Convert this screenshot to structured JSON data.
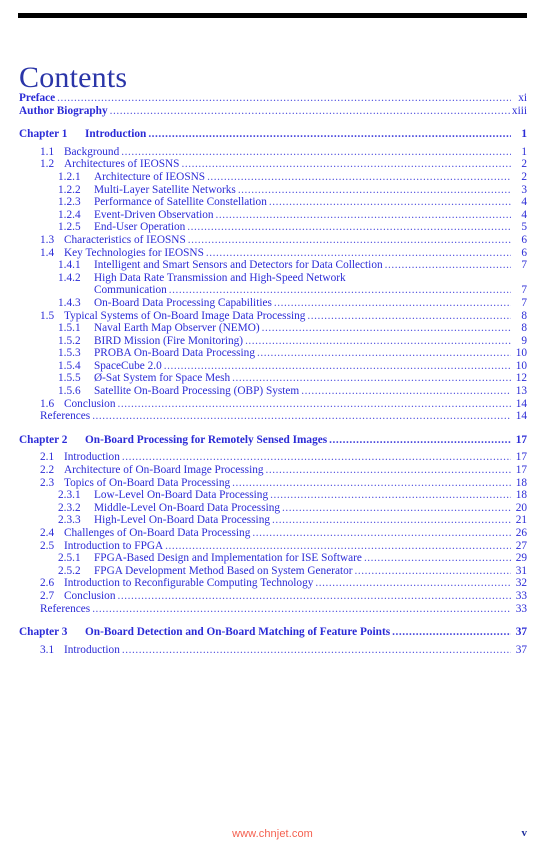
{
  "document": {
    "title": "Contents",
    "title_color": "#2a35a8",
    "text_color": "#2b2bd6",
    "rule_color": "#000000"
  },
  "front_matter": [
    {
      "number": "",
      "label": "Preface",
      "page": "xi"
    },
    {
      "number": "",
      "label": "Author Biography",
      "page": "xiii"
    }
  ],
  "chapters": [
    {
      "number": "Chapter 1",
      "label": "Introduction",
      "page": "1",
      "entries": [
        {
          "level": "sec",
          "number": "1.1",
          "label": "Background",
          "page": "1"
        },
        {
          "level": "sec",
          "number": "1.2",
          "label": "Architectures of IEOSNS",
          "page": "2"
        },
        {
          "level": "sub",
          "number": "1.2.1",
          "label": "Architecture of IEOSNS",
          "page": "2"
        },
        {
          "level": "sub",
          "number": "1.2.2",
          "label": "Multi-Layer Satellite Networks",
          "page": "3"
        },
        {
          "level": "sub",
          "number": "1.2.3",
          "label": "Performance of Satellite Constellation",
          "page": "4"
        },
        {
          "level": "sub",
          "number": "1.2.4",
          "label": "Event-Driven Observation",
          "page": "4"
        },
        {
          "level": "sub",
          "number": "1.2.5",
          "label": "End-User Operation",
          "page": "5"
        },
        {
          "level": "sec",
          "number": "1.3",
          "label": "Characteristics of IEOSNS",
          "page": "6"
        },
        {
          "level": "sec",
          "number": "1.4",
          "label": "Key Technologies for IEOSNS",
          "page": "6"
        },
        {
          "level": "sub",
          "number": "1.4.1",
          "label": "Intelligent and Smart Sensors and Detectors for Data Collection",
          "page": "7"
        },
        {
          "level": "sub",
          "number": "1.4.2",
          "label": "High Data Rate Transmission and High-Speed Network",
          "page": "",
          "no_leader": true
        },
        {
          "level": "cont",
          "number": "",
          "label": "Communication",
          "page": "7"
        },
        {
          "level": "sub",
          "number": "1.4.3",
          "label": "On-Board Data Processing Capabilities",
          "page": "7"
        },
        {
          "level": "sec",
          "number": "1.5",
          "label": "Typical Systems of On-Board Image Data Processing",
          "page": "8"
        },
        {
          "level": "sub",
          "number": "1.5.1",
          "label": "Naval Earth Map Observer (NEMO)",
          "page": "8"
        },
        {
          "level": "sub",
          "number": "1.5.2",
          "label": "BIRD Mission (Fire Monitoring)",
          "page": "9"
        },
        {
          "level": "sub",
          "number": "1.5.3",
          "label": "PROBA On-Board Data Processing",
          "page": "10"
        },
        {
          "level": "sub",
          "number": "1.5.4",
          "label": "SpaceCube 2.0",
          "page": "10"
        },
        {
          "level": "sub",
          "number": "1.5.5",
          "label": "Ø-Sat System for Space Mesh",
          "page": "12"
        },
        {
          "level": "sub",
          "number": "1.5.6",
          "label": "Satellite On-Board Processing (OBP) System",
          "page": "13"
        },
        {
          "level": "sec",
          "number": "1.6",
          "label": "Conclusion",
          "page": "14"
        },
        {
          "level": "refs",
          "number": "",
          "label": "References",
          "page": "14"
        }
      ]
    },
    {
      "number": "Chapter 2",
      "label": "On-Board Processing for Remotely Sensed Images",
      "page": "17",
      "entries": [
        {
          "level": "sec",
          "number": "2.1",
          "label": "Introduction",
          "page": "17"
        },
        {
          "level": "sec",
          "number": "2.2",
          "label": "Architecture of On-Board Image Processing",
          "page": "17"
        },
        {
          "level": "sec",
          "number": "2.3",
          "label": "Topics of On-Board Data Processing",
          "page": "18"
        },
        {
          "level": "sub",
          "number": "2.3.1",
          "label": "Low-Level On-Board Data Processing",
          "page": "18"
        },
        {
          "level": "sub",
          "number": "2.3.2",
          "label": "Middle-Level On-Board Data Processing",
          "page": "20"
        },
        {
          "level": "sub",
          "number": "2.3.3",
          "label": "High-Level On-Board Data Processing",
          "page": "21"
        },
        {
          "level": "sec",
          "number": "2.4",
          "label": "Challenges of On-Board Data Processing",
          "page": "26"
        },
        {
          "level": "sec",
          "number": "2.5",
          "label": "Introduction to FPGA",
          "page": "27"
        },
        {
          "level": "sub",
          "number": "2.5.1",
          "label": "FPGA-Based Design and Implementation for ISE Software",
          "page": "29"
        },
        {
          "level": "sub",
          "number": "2.5.2",
          "label": "FPGA Development Method Based on System Generator",
          "page": "31"
        },
        {
          "level": "sec",
          "number": "2.6",
          "label": "Introduction to Reconfigurable Computing Technology",
          "page": "32"
        },
        {
          "level": "sec",
          "number": "2.7",
          "label": "Conclusion",
          "page": "33"
        },
        {
          "level": "refs",
          "number": "",
          "label": "References",
          "page": "33"
        }
      ]
    },
    {
      "number": "Chapter 3",
      "label": "On-Board Detection and On-Board Matching of Feature Points",
      "page": "37",
      "entries": [
        {
          "level": "sec",
          "number": "3.1",
          "label": "Introduction",
          "page": "37"
        }
      ]
    }
  ],
  "footer": {
    "watermark": "www.chnjet.com",
    "watermark_color": "#f4604f",
    "page_number": "v"
  }
}
